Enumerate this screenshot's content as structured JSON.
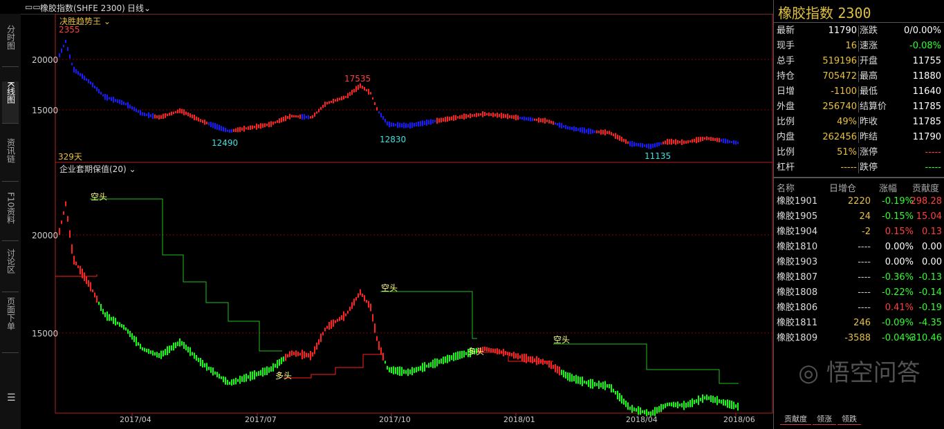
{
  "header": {
    "symbol_label": "橡胶指数(SHFE 2300)",
    "period": "日线"
  },
  "sidebar": {
    "tabs": [
      "分时图",
      "K线图",
      "资讯链",
      "F10资料",
      "讨论区",
      "页面下单"
    ]
  },
  "panel1": {
    "indicator": "决胜趋势王",
    "high_label": "2355",
    "y_ticks": [
      "20000",
      "15000"
    ],
    "days_label": "329天",
    "annotations": [
      "17535",
      "12490",
      "12830",
      "11135"
    ]
  },
  "panel2": {
    "indicator": "企业套期保值(20)",
    "y_ticks": [
      "20000",
      "15000"
    ],
    "signals": [
      "空头",
      "空头",
      "空头",
      "多头",
      "多头"
    ]
  },
  "x_axis": [
    "2017/04",
    "2017/07",
    "2017/10",
    "2018/01",
    "2018/04",
    "2018/06"
  ],
  "quote": {
    "title": "橡胶指数",
    "code": "2300",
    "rows": [
      {
        "l1": "最新",
        "v1": "11790",
        "l2": "涨跌",
        "v2": "0/0.00%"
      },
      {
        "l1": "现手",
        "v1": "16",
        "l2": "速涨",
        "v2": "-0.08%"
      },
      {
        "l1": "总手",
        "v1": "519196",
        "l2": "开盘",
        "v2": "11755"
      },
      {
        "l1": "持仓",
        "v1": "705472",
        "l2": "最高",
        "v2": "11880"
      },
      {
        "l1": "日增",
        "v1": "-1100",
        "l2": "最低",
        "v2": "11640"
      },
      {
        "l1": "外盘",
        "v1": "256740",
        "l2": "结算价",
        "v2": "11785"
      },
      {
        "l1": "比例",
        "v1": "49%",
        "l2": "昨收",
        "v2": "11785"
      },
      {
        "l1": "内盘",
        "v1": "262456",
        "l2": "昨结",
        "v2": "11790"
      },
      {
        "l1": "比例",
        "v1": "51%",
        "l2": "涨停",
        "v2": "-----"
      },
      {
        "l1": "杠杆",
        "v1": "-----",
        "l2": "跌停",
        "v2": "-----"
      }
    ]
  },
  "contracts": {
    "headers": [
      "名称",
      "日增仓",
      "涨幅",
      "贡献度"
    ],
    "rows": [
      {
        "name": "橡胶1901",
        "oi": "2220",
        "chg": "-0.19%",
        "contrib": "298.28"
      },
      {
        "name": "橡胶1905",
        "oi": "24",
        "chg": "-0.15%",
        "contrib": "15.04"
      },
      {
        "name": "橡胶1904",
        "oi": "-2",
        "chg": "0.15%",
        "contrib": "0.13"
      },
      {
        "name": "橡胶1810",
        "oi": "----",
        "chg": "0.00%",
        "contrib": "0.00"
      },
      {
        "name": "橡胶1903",
        "oi": "----",
        "chg": "0.00%",
        "contrib": "0.00"
      },
      {
        "name": "橡胶1807",
        "oi": "----",
        "chg": "-0.36%",
        "contrib": "-0.13"
      },
      {
        "name": "橡胶1808",
        "oi": "----",
        "chg": "-0.22%",
        "contrib": "-0.14"
      },
      {
        "name": "橡胶1806",
        "oi": "----",
        "chg": "0.41%",
        "contrib": "-0.19"
      },
      {
        "name": "橡胶1811",
        "oi": "246",
        "chg": "-0.09%",
        "contrib": "-4.35"
      },
      {
        "name": "橡胶1809",
        "oi": "-3588",
        "chg": "-0.04%",
        "contrib": "-310.46"
      }
    ]
  },
  "bottom_tabs": [
    "贡献度",
    "领涨",
    "领跌"
  ],
  "watermark": "悟空问答",
  "colors": {
    "up": "#ff2020",
    "down_blue": "#1a1aff",
    "down_green": "#10ff10",
    "gold": "#e8c040",
    "grid": "#8b0000"
  }
}
